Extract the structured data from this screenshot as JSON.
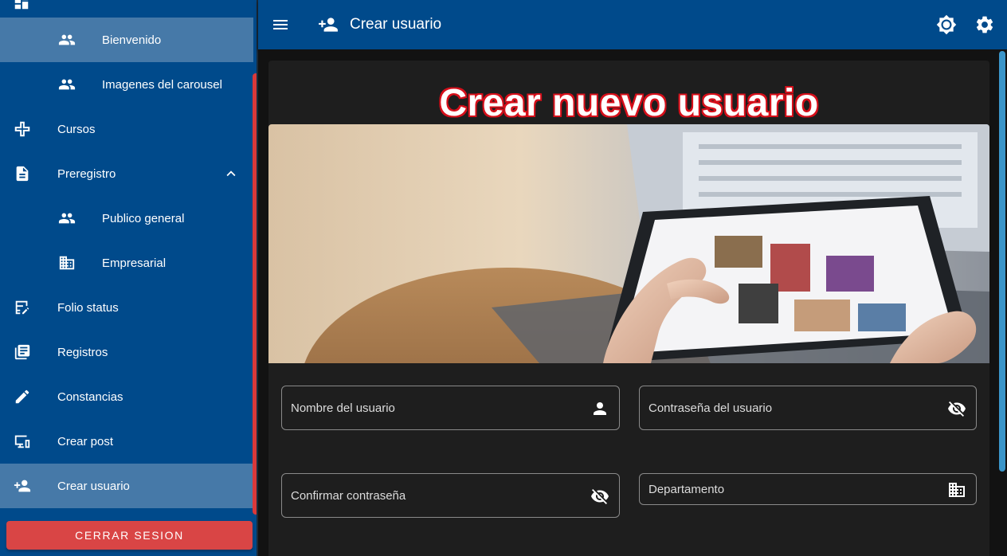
{
  "sidebar": {
    "items": [
      {
        "label": "Bienvenido",
        "icon": "people-icon"
      },
      {
        "label": "Imagenes del carousel",
        "icon": "people-icon"
      },
      {
        "label": "Cursos",
        "icon": "plus-icon"
      },
      {
        "label": "Preregistro",
        "icon": "document-icon"
      },
      {
        "label": "Publico general",
        "icon": "people-icon"
      },
      {
        "label": "Empresarial",
        "icon": "building-icon"
      },
      {
        "label": "Folio status",
        "icon": "table-edit-icon"
      },
      {
        "label": "Registros",
        "icon": "library-icon"
      },
      {
        "label": "Constancias",
        "icon": "pencil-icon"
      },
      {
        "label": "Crear post",
        "icon": "monitor-icon"
      },
      {
        "label": "Crear usuario",
        "icon": "person-add-icon"
      }
    ],
    "logout_label": "CERRAR SESION"
  },
  "appbar": {
    "title": "Crear usuario",
    "icons": [
      "menu-icon",
      "person-add-icon",
      "brightness-icon",
      "gear-icon"
    ]
  },
  "main": {
    "heading": "Crear nuevo usuario",
    "fields": {
      "username_placeholder": "Nombre del usuario",
      "password_placeholder": "Contraseña del usuario",
      "confirm_placeholder": "Confirmar contraseña",
      "department_placeholder": "Departamento"
    }
  },
  "colors": {
    "sidebar_bg": "#004a8b",
    "active_item": "#4679a8",
    "logout_button": "#d94545",
    "heading_outline": "#d60f1a",
    "card_bg": "#1e1e1e",
    "scrollbar": "#3a95c9"
  }
}
